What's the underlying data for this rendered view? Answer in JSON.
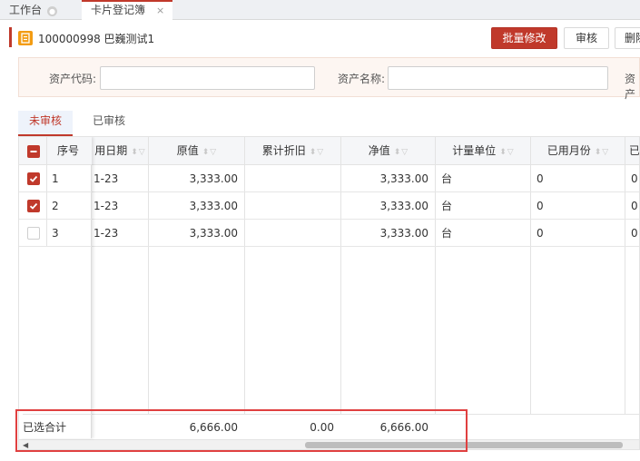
{
  "tabs": {
    "home_label": "工作台",
    "active_label": "卡片登记簿",
    "close_glyph": "×"
  },
  "record": {
    "title": "100000998 巴巍测试1",
    "accent_color": "#c0392b",
    "icon_color": "#f39c12"
  },
  "toolbar": {
    "batch_edit_label": "批量修改",
    "audit_label": "审核",
    "delete_label": "删除"
  },
  "search": {
    "asset_code_label": "资产代码:",
    "asset_code_value": "",
    "asset_name_label": "资产名称:",
    "asset_name_value": "",
    "third_label": "资产"
  },
  "status_tabs": {
    "unaudited": "未审核",
    "audited": "已审核"
  },
  "table": {
    "headers": {
      "seq": "序号",
      "date": "用日期",
      "original": "原值",
      "depreciation": "累计折旧",
      "net": "净值",
      "unit": "计量单位",
      "months": "已用月份",
      "extra": "已"
    },
    "rows": [
      {
        "checked": true,
        "seq": "1",
        "date": "1-23",
        "original": "3,333.00",
        "depreciation": "",
        "net": "3,333.00",
        "unit": "台",
        "months": "0",
        "extra": "0"
      },
      {
        "checked": true,
        "seq": "2",
        "date": "1-23",
        "original": "3,333.00",
        "depreciation": "",
        "net": "3,333.00",
        "unit": "台",
        "months": "0",
        "extra": "0"
      },
      {
        "checked": false,
        "seq": "3",
        "date": "1-23",
        "original": "3,333.00",
        "depreciation": "",
        "net": "3,333.00",
        "unit": "台",
        "months": "0",
        "extra": "0"
      }
    ],
    "footer": {
      "label": "已选合计",
      "original": "6,666.00",
      "depreciation": "0.00",
      "net": "6,666.00"
    }
  },
  "colors": {
    "primary": "#c0392b",
    "highlight": "#e04040"
  }
}
